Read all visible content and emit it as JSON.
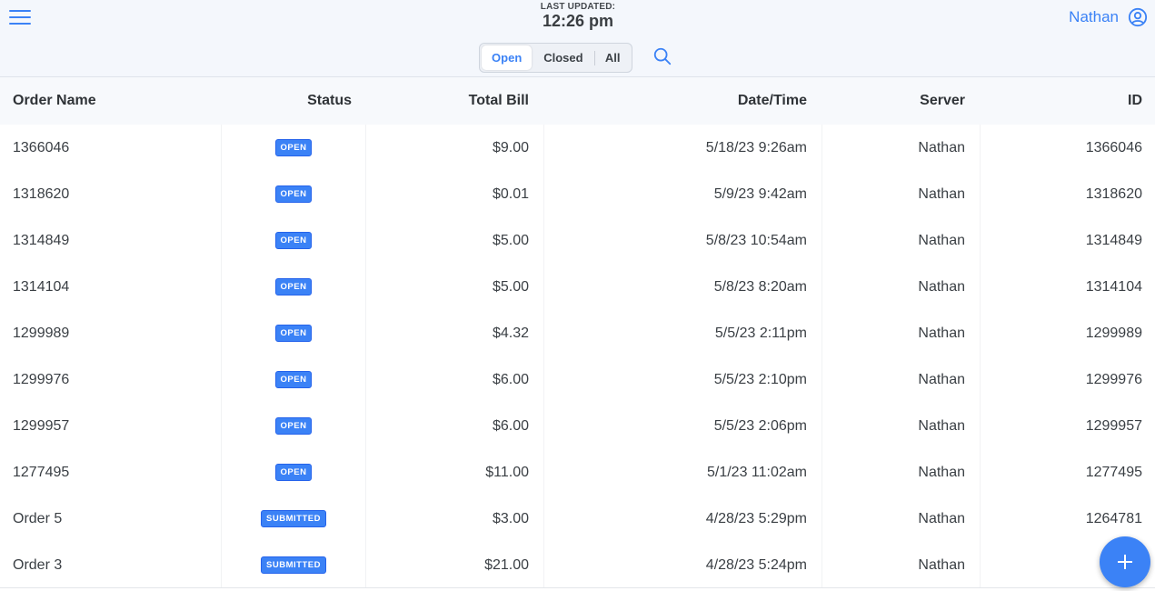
{
  "header": {
    "updated_label": "LAST UPDATED:",
    "updated_time": "12:26 pm",
    "user_name": "Nathan",
    "tabs": [
      {
        "label": "Open",
        "active": true
      },
      {
        "label": "Closed",
        "active": false
      },
      {
        "label": "All",
        "active": false
      }
    ]
  },
  "icons": {
    "menu": "menu-icon",
    "user": "user-circle-icon",
    "search": "search-icon",
    "add": "plus-icon"
  },
  "colors": {
    "accent": "#3b82f6",
    "header_bg": "#f4f7fc"
  },
  "table": {
    "columns": [
      "Order Name",
      "Status",
      "Total Bill",
      "Date/Time",
      "Server",
      "ID"
    ],
    "rows": [
      {
        "name": "1366046",
        "status": "OPEN",
        "total": "$9.00",
        "datetime": "5/18/23 9:26am",
        "server": "Nathan",
        "id": "1366046"
      },
      {
        "name": "1318620",
        "status": "OPEN",
        "total": "$0.01",
        "datetime": "5/9/23 9:42am",
        "server": "Nathan",
        "id": "1318620"
      },
      {
        "name": "1314849",
        "status": "OPEN",
        "total": "$5.00",
        "datetime": "5/8/23 10:54am",
        "server": "Nathan",
        "id": "1314849"
      },
      {
        "name": "1314104",
        "status": "OPEN",
        "total": "$5.00",
        "datetime": "5/8/23 8:20am",
        "server": "Nathan",
        "id": "1314104"
      },
      {
        "name": "1299989",
        "status": "OPEN",
        "total": "$4.32",
        "datetime": "5/5/23 2:11pm",
        "server": "Nathan",
        "id": "1299989"
      },
      {
        "name": "1299976",
        "status": "OPEN",
        "total": "$6.00",
        "datetime": "5/5/23 2:10pm",
        "server": "Nathan",
        "id": "1299976"
      },
      {
        "name": "1299957",
        "status": "OPEN",
        "total": "$6.00",
        "datetime": "5/5/23 2:06pm",
        "server": "Nathan",
        "id": "1299957"
      },
      {
        "name": "1277495",
        "status": "OPEN",
        "total": "$11.00",
        "datetime": "5/1/23 11:02am",
        "server": "Nathan",
        "id": "1277495"
      },
      {
        "name": "Order 5",
        "status": "SUBMITTED",
        "total": "$3.00",
        "datetime": "4/28/23 5:29pm",
        "server": "Nathan",
        "id": "1264781"
      },
      {
        "name": "Order 3",
        "status": "SUBMITTED",
        "total": "$21.00",
        "datetime": "4/28/23 5:24pm",
        "server": "Nathan",
        "id": "12"
      }
    ]
  }
}
